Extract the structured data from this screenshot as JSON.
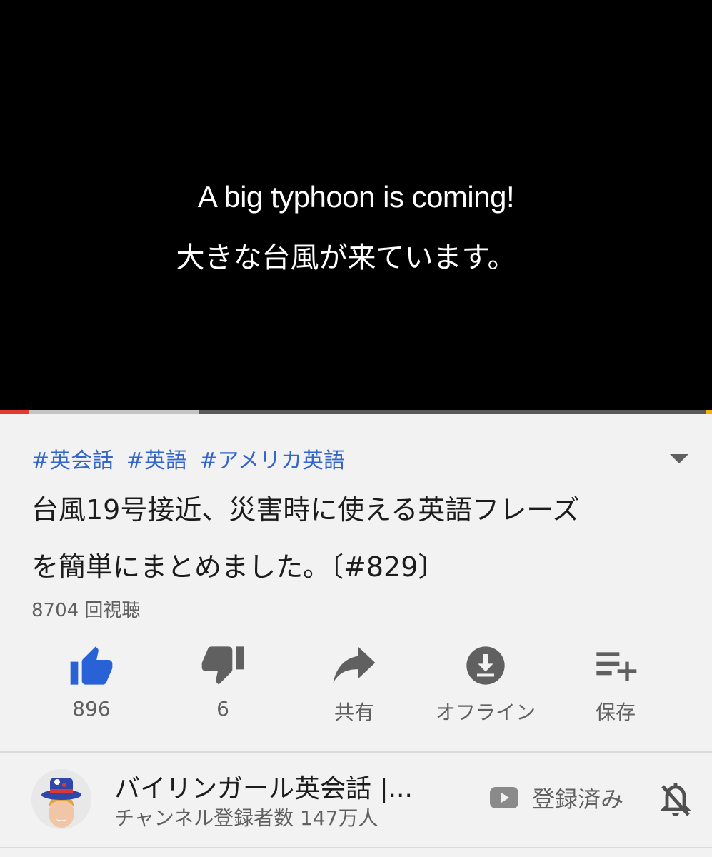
{
  "player": {
    "subtitle_en": "A big typhoon is coming!",
    "subtitle_ja": "大きな台風が来ています。",
    "progress": 0.04,
    "buffered": 0.28,
    "colors": {
      "played": "#e53b2f",
      "buffered": "#c4c4c4",
      "track": "#5a5a5a"
    }
  },
  "video": {
    "hashtags": [
      "#英会話",
      "#英語",
      "#アメリカ英語"
    ],
    "title_line1": "台風19号接近、災害時に使える英語フレーズ",
    "title_line2": "を簡単にまとめました。〔#829〕",
    "views": "8704 回視聴"
  },
  "actions": {
    "like": {
      "icon": "thumbs-up-icon",
      "label": "896",
      "color": "#2862d6"
    },
    "dislike": {
      "icon": "thumbs-down-icon",
      "label": "6"
    },
    "share": {
      "icon": "share-icon",
      "label": "共有"
    },
    "download": {
      "icon": "download-icon",
      "label": "オフライン"
    },
    "save": {
      "icon": "playlist-add-icon",
      "label": "保存"
    }
  },
  "channel": {
    "name": "バイリンガール英会話 |...",
    "subscribers": "チャンネル登録者数 147万人",
    "subscribed_label": "登録済み",
    "icons": [
      "youtube-icon",
      "bell-off-icon"
    ]
  }
}
